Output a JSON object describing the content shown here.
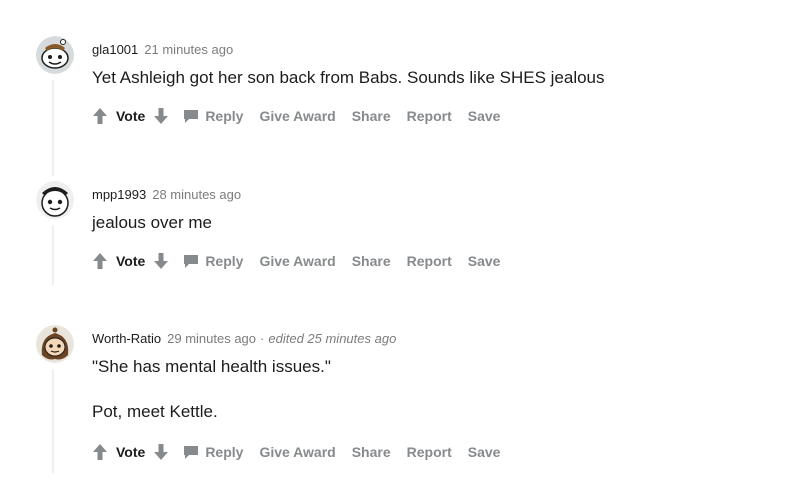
{
  "colors": {
    "text": "#1c1c1c",
    "muted": "#7c7c7c",
    "action": "#878a8c",
    "thread_line": "#edeff1"
  },
  "actions": {
    "vote": "Vote",
    "reply": "Reply",
    "give_award": "Give Award",
    "share": "Share",
    "report": "Report",
    "save": "Save"
  },
  "comments": [
    {
      "username": "gla1001",
      "time": "21 minutes ago",
      "edited": "",
      "body": [
        "Yet Ashleigh got her son back from Babs. Sounds like SHES jealous"
      ],
      "avatar_icon": "snoo-avatar-icon"
    },
    {
      "username": "mpp1993",
      "time": "28 minutes ago",
      "edited": "",
      "body": [
        "jealous over me"
      ],
      "avatar_icon": "snoo-avatar-icon"
    },
    {
      "username": "Worth-Ratio",
      "time": "29 minutes ago",
      "edited": "edited 25 minutes ago",
      "body": [
        "\"She has mental health issues.\"",
        "Pot, meet Kettle."
      ],
      "avatar_icon": "snoo-avatar-icon"
    }
  ]
}
